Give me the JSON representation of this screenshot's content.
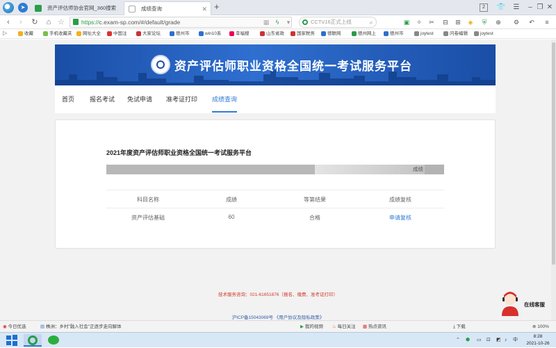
{
  "browser": {
    "tabs": [
      {
        "label": "资产评估师协会官网_360搜索",
        "active": false
      },
      {
        "label": "成绩查询",
        "active": true
      }
    ],
    "new_tab": "+",
    "url_https": "https://",
    "url_rest": "c.exam-sp.com/#/default/grade",
    "search_placeholder": "CCTV16正式上线",
    "page_counter": "2"
  },
  "bookmarks": [
    {
      "label": "收藏",
      "color": "#f2b01e"
    },
    {
      "label": "手机收藏夹",
      "color": "#7cbf4a"
    },
    {
      "label": "网址大全",
      "color": "#f2b01e"
    },
    {
      "label": "中国注",
      "color": "#d33"
    },
    {
      "label": "大家论坛",
      "color": "#c33"
    },
    {
      "label": "德州市",
      "color": "#2f6fd0"
    },
    {
      "label": "win10系",
      "color": "#2f6fd0"
    },
    {
      "label": "幸福搜",
      "color": "#e05"
    },
    {
      "label": "山东省政",
      "color": "#c33"
    },
    {
      "label": "国家税务",
      "color": "#c33"
    },
    {
      "label": "德联网",
      "color": "#2f6fd0"
    },
    {
      "label": "德州网上",
      "color": "#2a9d4a"
    },
    {
      "label": "德州市",
      "color": "#2f6fd0"
    },
    {
      "label": "joytest",
      "color": "#888"
    },
    {
      "label": "问卷编辑",
      "color": "#888"
    },
    {
      "label": "joytest",
      "color": "#888"
    }
  ],
  "banner": {
    "title": "资产评估师职业资格全国统一考试服务平台"
  },
  "nav": [
    {
      "label": "首页",
      "active": false
    },
    {
      "label": "报名考试",
      "active": false
    },
    {
      "label": "免试申请",
      "active": false
    },
    {
      "label": "准考证打印",
      "active": false
    },
    {
      "label": "成绩查询",
      "active": true
    }
  ],
  "result": {
    "title": "2021年度资产评估师职业资格全国统一考试服务平台",
    "masked_label": "成绩",
    "headers": [
      "科目名称",
      "成绩",
      "等第结果",
      "成绩复核"
    ],
    "rows": [
      {
        "subject": "资产评估基础",
        "score": "60",
        "result": "合格",
        "action": "申请复核"
      }
    ]
  },
  "footer": {
    "hotline": "技术服务咨询：021-61651876（报名、缴费、准考证打印）",
    "icp": "沪ICP备15043069号  《用户协议及隐私政策》"
  },
  "service": {
    "label": "在线客服"
  },
  "statusbar": {
    "left": "今日优选",
    "news": "株洲：乡村\"融入社会\"正逐步走向解体",
    "items": [
      "我的视频",
      "每日关注",
      "热点资讯",
      "下载"
    ],
    "zoom": "100%"
  },
  "taskbar": {
    "time": "8:28",
    "date": "2021-10-26",
    "lang": "中"
  }
}
